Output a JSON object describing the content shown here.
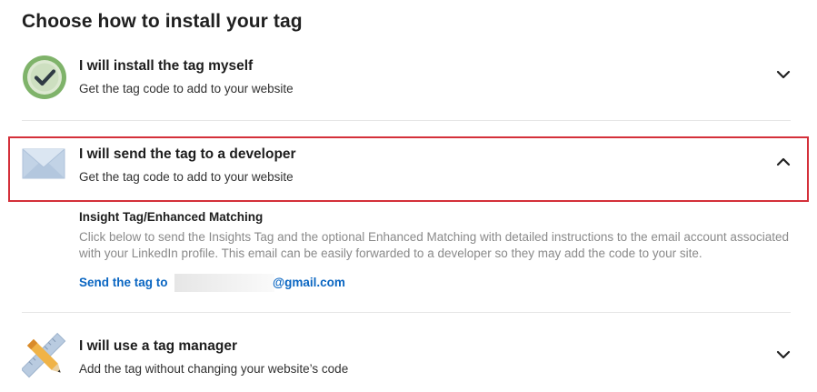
{
  "page": {
    "title": "Choose how to install your tag"
  },
  "options": [
    {
      "title": "I will install the tag myself",
      "description": "Get the tag code to add to your website",
      "icon": "check-circle-icon",
      "expanded": false
    },
    {
      "title": "I will send the tag to a developer",
      "description": "Get the tag code to add to your website",
      "icon": "envelope-icon",
      "expanded": true
    },
    {
      "title": "I will use a tag manager",
      "description": "Add the tag without changing your website’s code",
      "icon": "pencil-ruler-icon",
      "expanded": false
    }
  ],
  "developer_panel": {
    "heading": "Insight Tag/Enhanced Matching",
    "body": "Click below to send the Insights Tag and the optional Enhanced Matching with detailed instructions to the email account associated with your LinkedIn profile. This email can be easily forwarded to a developer so they may add the code to your site.",
    "send_label": "Send the tag to",
    "email_domain": "@gmail.com"
  },
  "colors": {
    "link": "#0a66c2",
    "highlight_border": "#d4303a",
    "check_green": "#6aa84f"
  }
}
